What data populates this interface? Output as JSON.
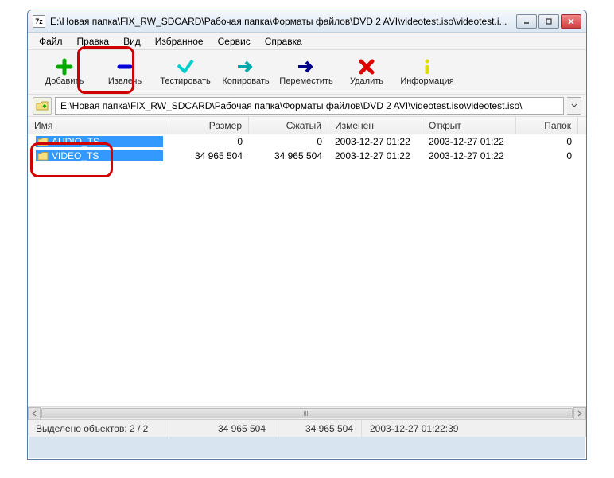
{
  "window": {
    "icon_text": "7z",
    "title": "E:\\Новая папка\\FIX_RW_SDCARD\\Рабочая папка\\Форматы файлов\\DVD 2 AVI\\videotest.iso\\videotest.i..."
  },
  "menu": {
    "file": "Файл",
    "edit": "Правка",
    "view": "Вид",
    "favorites": "Избранное",
    "service": "Сервис",
    "help": "Справка"
  },
  "toolbar": {
    "add": "Добавить",
    "extract": "Извлечь",
    "test": "Тестировать",
    "copy": "Копировать",
    "move": "Переместить",
    "delete": "Удалить",
    "info": "Информация"
  },
  "path": "E:\\Новая папка\\FIX_RW_SDCARD\\Рабочая папка\\Форматы файлов\\DVD 2 AVI\\videotest.iso\\videotest.iso\\",
  "columns": {
    "name": "Имя",
    "size": "Размер",
    "compressed": "Сжатый",
    "modified": "Изменен",
    "opened": "Открыт",
    "folders": "Папок"
  },
  "rows": [
    {
      "name": "AUDIO_TS",
      "size": "0",
      "compressed": "0",
      "modified": "2003-12-27 01:22",
      "opened": "2003-12-27 01:22",
      "folders": "0"
    },
    {
      "name": "VIDEO_TS",
      "size": "34 965 504",
      "compressed": "34 965 504",
      "modified": "2003-12-27 01:22",
      "opened": "2003-12-27 01:22",
      "folders": "0"
    }
  ],
  "status": {
    "selected": "Выделено объектов: 2 / 2",
    "size": "34 965 504",
    "compressed": "34 965 504",
    "date": "2003-12-27 01:22:39"
  }
}
